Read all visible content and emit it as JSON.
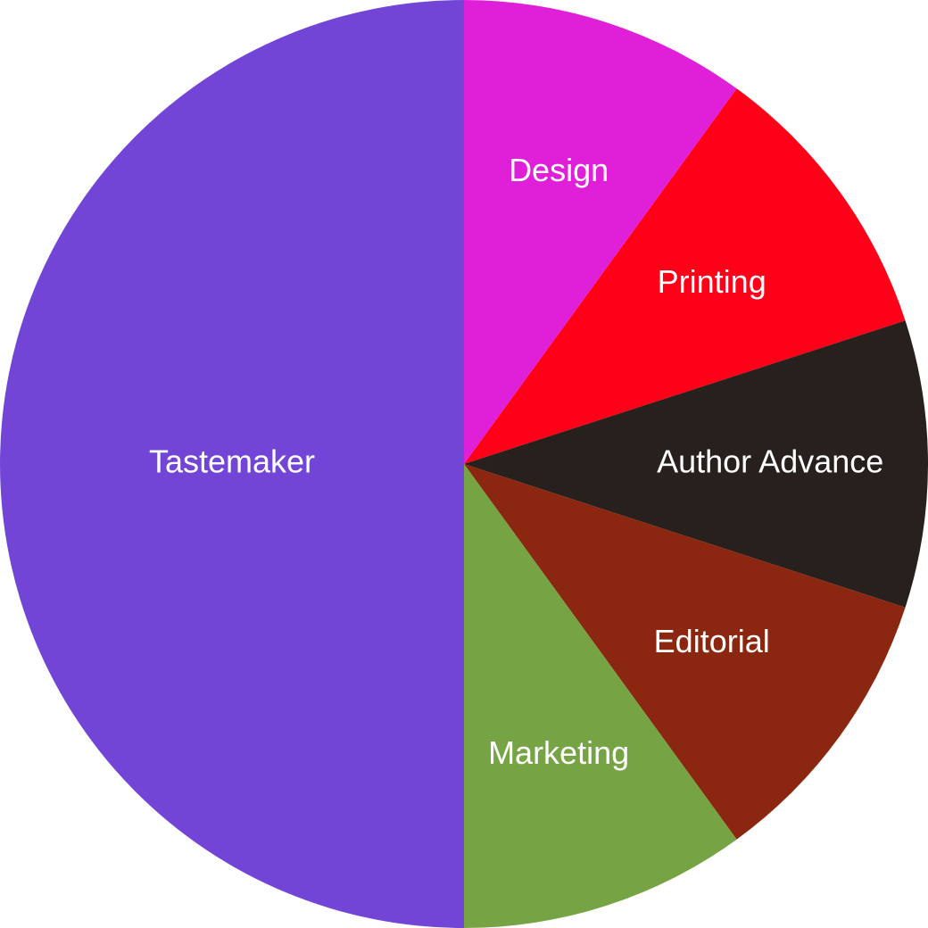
{
  "chart_data": {
    "type": "pie",
    "start_angle": "12 o'clock",
    "direction": "clockwise",
    "slices": [
      {
        "label": "Design",
        "value": 10,
        "color": "#e020d8"
      },
      {
        "label": "Printing",
        "value": 10,
        "color": "#ff0019"
      },
      {
        "label": "Author Advance",
        "value": 10,
        "color": "#27201d"
      },
      {
        "label": "Editorial",
        "value": 10,
        "color": "#8b2711"
      },
      {
        "label": "Marketing",
        "value": 10,
        "color": "#76a343"
      },
      {
        "label": "Tastemaker",
        "value": 50,
        "color": "#7245d6"
      }
    ]
  }
}
